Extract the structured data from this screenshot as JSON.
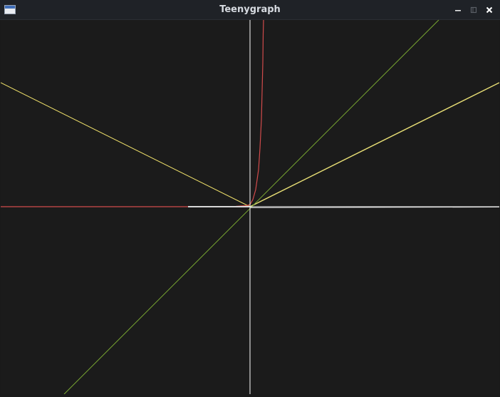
{
  "window": {
    "title": "Teenygraph",
    "controls": [
      {
        "name": "minimize-button",
        "icon": "minimize-icon"
      },
      {
        "name": "maximize-button",
        "icon": "maximize-icon"
      },
      {
        "name": "close-button",
        "icon": "close-icon"
      }
    ]
  },
  "plot": {
    "background": "#1b1b1b",
    "axes_color": "#ffffff",
    "curves": [
      {
        "name": "yellow-line-steep",
        "color": "#f2e36b"
      },
      {
        "name": "yellow-line-shallow",
        "color": "#e8df75"
      },
      {
        "name": "green-line",
        "color": "#7aa832"
      },
      {
        "name": "red-curve",
        "color": "#d14b4b"
      }
    ]
  }
}
